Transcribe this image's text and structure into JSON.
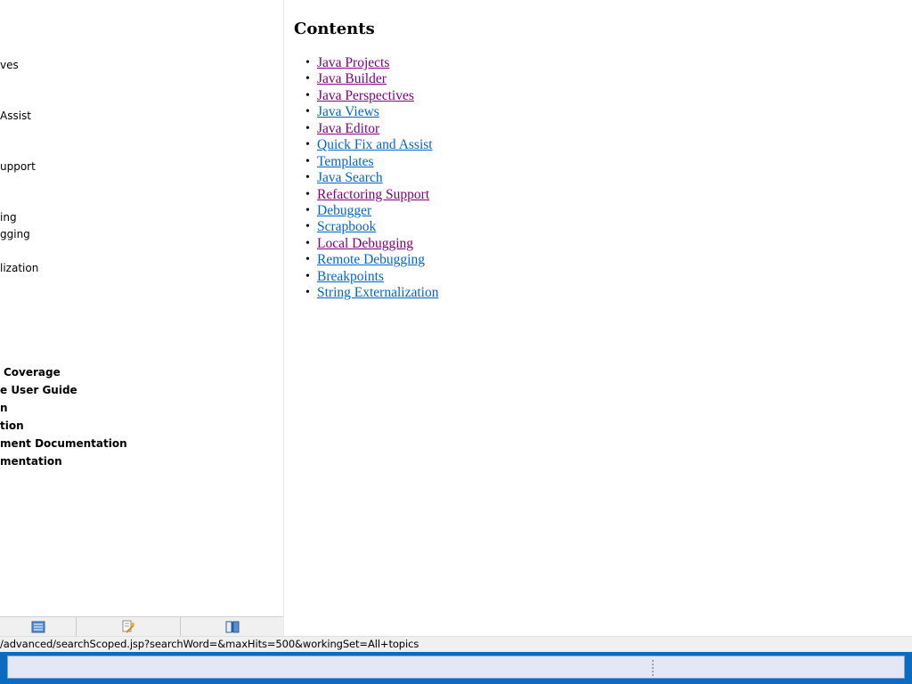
{
  "toc": {
    "items": [
      {
        "text": "ves",
        "bold": false
      },
      {
        "text": "Assist",
        "bold": false
      },
      {
        "text": "upport",
        "bold": false
      },
      {
        "text": "ing",
        "bold": false
      },
      {
        "text": "gging",
        "bold": false
      },
      {
        "text": "lization",
        "bold": false
      },
      {
        "text": "Coverage",
        "bold": true
      },
      {
        "text": "e User Guide",
        "bold": true
      },
      {
        "text": "n",
        "bold": true
      },
      {
        "text": "tion",
        "bold": true
      },
      {
        "text": "ment Documentation",
        "bold": true
      },
      {
        "text": "mentation",
        "bold": true
      }
    ],
    "toolbar": [
      {
        "icon": "contents-icon"
      },
      {
        "icon": "search-results-icon"
      },
      {
        "icon": "bookmarks-icon"
      }
    ]
  },
  "content": {
    "title": "Contents",
    "links": [
      {
        "label": "Java Projects",
        "visited": true
      },
      {
        "label": "Java Builder",
        "visited": true
      },
      {
        "label": "Java Perspectives",
        "visited": true
      },
      {
        "label": "Java Views",
        "visited": false
      },
      {
        "label": "Java Editor",
        "visited": true
      },
      {
        "label": "Quick Fix and Assist",
        "visited": false
      },
      {
        "label": "Templates",
        "visited": false
      },
      {
        "label": "Java Search",
        "visited": false
      },
      {
        "label": "Refactoring Support",
        "visited": true
      },
      {
        "label": "Debugger",
        "visited": false
      },
      {
        "label": "Scrapbook",
        "visited": false
      },
      {
        "label": "Local Debugging",
        "visited": true
      },
      {
        "label": "Remote Debugging",
        "visited": false
      },
      {
        "label": "Breakpoints",
        "visited": false
      },
      {
        "label": "String Externalization",
        "visited": false
      }
    ]
  },
  "status": {
    "text": "/advanced/searchScoped.jsp?searchWord=&maxHits=500&workingSet=All+topics"
  },
  "colors": {
    "visited_link": "#800080",
    "unvisited_link": "#0066cc",
    "taskbar": "#0a6bbf"
  }
}
